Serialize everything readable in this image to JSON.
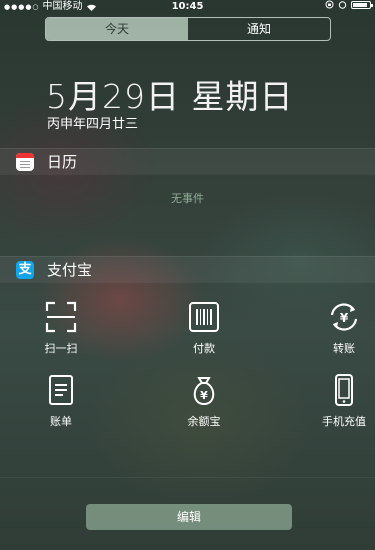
{
  "status_bar": {
    "carrier": "中国移动",
    "time": "10:45"
  },
  "segment": {
    "tabs": [
      {
        "label": "今天",
        "active": true
      },
      {
        "label": "通知",
        "active": false
      }
    ]
  },
  "date": {
    "main": "5月29日 星期日",
    "lunar": "丙申年四月廿三"
  },
  "calendar_widget": {
    "title": "日历",
    "empty_text": "无事件",
    "icon": "calendar-icon"
  },
  "alipay_widget": {
    "title": "支付宝",
    "icon_glyph": "支",
    "icon": "alipay-icon",
    "items": [
      {
        "label": "扫一扫",
        "icon": "scan-icon"
      },
      {
        "label": "付款",
        "icon": "barcode-icon"
      },
      {
        "label": "转账",
        "icon": "transfer-icon"
      },
      {
        "label": "账单",
        "icon": "bill-icon"
      },
      {
        "label": "余额宝",
        "icon": "money-bag-icon"
      },
      {
        "label": "手机充值",
        "icon": "phone-icon"
      }
    ]
  },
  "footer": {
    "edit_label": "编辑"
  }
}
